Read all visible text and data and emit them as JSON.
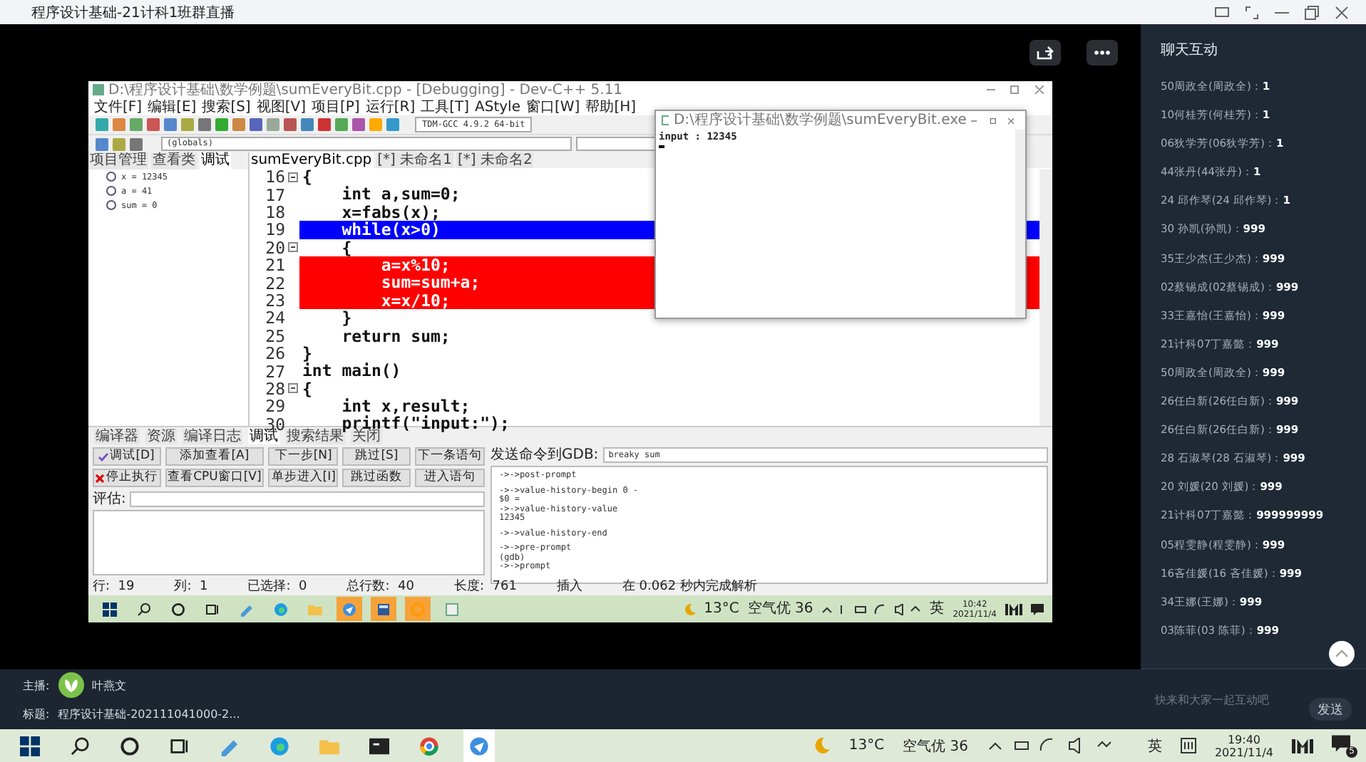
{
  "window": {
    "title": "程序设计基础-21计科1班群直播"
  },
  "shared_screen": {
    "ide": {
      "title": "D:\\程序设计基础\\数学例题\\sumEveryBit.cpp - [Debugging] - Dev-C++ 5.11",
      "menu": [
        "文件[F]",
        "编辑[E]",
        "搜索[S]",
        "视图[V]",
        "项目[P]",
        "运行[R]",
        "工具[T]",
        "AStyle",
        "窗口[W]",
        "帮助[H]"
      ],
      "compiler": "TDM-GCC 4.9.2 64-bit",
      "scope": "(globals)",
      "left_tabs": [
        {
          "label": "项目管理",
          "selected": false
        },
        {
          "label": "查看类",
          "selected": false
        },
        {
          "label": "调试",
          "selected": true
        }
      ],
      "watches": [
        "x = 12345",
        "a = 41",
        "sum = 0"
      ],
      "editor_tabs": [
        {
          "label": "sumEveryBit.cpp",
          "selected": true
        },
        {
          "label": "[*] 未命名1",
          "selected": false
        },
        {
          "label": "[*] 未命名2",
          "selected": false
        }
      ],
      "code": [
        {
          "n": "16",
          "text": "{",
          "kind": "normal",
          "fold": true
        },
        {
          "n": "17",
          "text": "    int a,sum=0;",
          "kind": "normal",
          "fold": false
        },
        {
          "n": "18",
          "text": "    x=fabs(x);",
          "kind": "normal",
          "fold": false
        },
        {
          "n": "19",
          "text": "    while(x>0)",
          "kind": "current",
          "fold": false
        },
        {
          "n": "20",
          "text": "    {",
          "kind": "normal",
          "fold": true
        },
        {
          "n": "21",
          "text": "        a=x%10;",
          "kind": "breakpoint",
          "fold": false
        },
        {
          "n": "22",
          "text": "        sum=sum+a;",
          "kind": "breakpoint",
          "fold": false
        },
        {
          "n": "23",
          "text": "        x=x/10;",
          "kind": "breakpoint",
          "fold": false
        },
        {
          "n": "24",
          "text": "    }",
          "kind": "normal",
          "fold": false
        },
        {
          "n": "25",
          "text": "    return sum;",
          "kind": "normal",
          "fold": false
        },
        {
          "n": "26",
          "text": "}",
          "kind": "normal",
          "fold": false
        },
        {
          "n": "27",
          "text": "int main()",
          "kind": "normal",
          "fold": false
        },
        {
          "n": "28",
          "text": "{",
          "kind": "normal",
          "fold": true
        },
        {
          "n": "29",
          "text": "    int x,result;",
          "kind": "normal",
          "fold": false
        },
        {
          "n": "30",
          "text": "    printf(\"input:\");",
          "kind": "normal",
          "fold": false
        }
      ],
      "bottom_tabs": [
        {
          "label": "编译器",
          "selected": false
        },
        {
          "label": "资源",
          "selected": false
        },
        {
          "label": "编译日志",
          "selected": false
        },
        {
          "label": "调试",
          "selected": true
        },
        {
          "label": "搜索结果",
          "selected": false
        },
        {
          "label": "关闭",
          "selected": false
        }
      ],
      "debug_buttons": [
        {
          "label": "调试[D]",
          "kind": "check"
        },
        {
          "label": "添加查看[A]",
          "kind": "plain"
        },
        {
          "label": "下一步[N]",
          "kind": "plain"
        },
        {
          "label": "跳过[S]",
          "kind": "plain"
        },
        {
          "label": "下一条语句",
          "kind": "plain"
        },
        {
          "label": "停止执行",
          "kind": "stop"
        },
        {
          "label": "查看CPU窗口[V]",
          "kind": "plain"
        },
        {
          "label": "单步进入[I]",
          "kind": "plain"
        },
        {
          "label": "跳过函数",
          "kind": "plain"
        },
        {
          "label": "进入语句",
          "kind": "plain"
        }
      ],
      "evaluate_label": "评估:",
      "gdb": {
        "label": "发送命令到GDB:",
        "value": "breaky sum"
      },
      "gdb_output": [
        [
          "->->post-prompt"
        ],
        [
          "->->value-history-begin 0 -",
          "$0 =",
          "->->value-history-value",
          "12345"
        ],
        [
          "->->value-history-end"
        ],
        [
          "->->pre-prompt",
          "(gdb)",
          "->->prompt"
        ]
      ],
      "status": [
        {
          "label": "行:",
          "value": "19"
        },
        {
          "label": "列:",
          "value": "1"
        },
        {
          "label": "已选择:",
          "value": "0"
        },
        {
          "label": "总行数:",
          "value": "40"
        },
        {
          "label": "长度:",
          "value": "761"
        },
        {
          "label": "插入"
        },
        {
          "label": "在 0.062 秒内完成解析"
        }
      ]
    },
    "console": {
      "title": "D:\\程序设计基础\\数学例题\\sumEveryBit.exe",
      "output": "input : 12345"
    },
    "taskbar": {
      "apps": [
        {
          "kind": "start",
          "selected": false
        },
        {
          "kind": "search",
          "selected": false
        },
        {
          "kind": "cortana",
          "selected": false
        },
        {
          "kind": "taskview",
          "selected": false
        },
        {
          "kind": "pen",
          "selected": false
        },
        {
          "kind": "edge",
          "selected": false
        },
        {
          "kind": "folder",
          "selected": false
        },
        {
          "kind": "bird",
          "selected": true
        },
        {
          "kind": "calc",
          "selected": true
        },
        {
          "kind": "ring",
          "selected": true
        },
        {
          "kind": "app",
          "selected": false
        }
      ],
      "weather": "13°C",
      "air": "空气优 36",
      "ime": "英",
      "time": "10:42",
      "date": "2021/11/4"
    }
  },
  "chat": {
    "title": "聊天互动",
    "messages": [
      {
        "sender": "50周政全(周政全)：",
        "text": "1"
      },
      {
        "sender": "10何桂芳(何桂芳)：",
        "text": "1"
      },
      {
        "sender": "06狄学芳(06狄学芳)：",
        "text": "1"
      },
      {
        "sender": "44张丹(44张丹)：",
        "text": "1"
      },
      {
        "sender": "24 邱作琴(24 邱作琴)：",
        "text": "1"
      },
      {
        "sender": "30 孙凯(孙凯)：",
        "text": "999"
      },
      {
        "sender": "35王少杰(王少杰)：",
        "text": "999"
      },
      {
        "sender": "02蔡锡成(02蔡锡成)：",
        "text": "999"
      },
      {
        "sender": "33王嘉怡(王嘉怡)：",
        "text": "999"
      },
      {
        "sender": "21计科07丁嘉懿：",
        "text": "999"
      },
      {
        "sender": "50周政全(周政全)：",
        "text": "999"
      },
      {
        "sender": "26任白新(26任白新)：",
        "text": "999"
      },
      {
        "sender": "26任白新(26任白新)：",
        "text": "999"
      },
      {
        "sender": "28 石淑琴(28 石淑琴)：",
        "text": "999"
      },
      {
        "sender": "20 刘媛(20 刘媛)：",
        "text": "999"
      },
      {
        "sender": "21计科07丁嘉懿：",
        "text": "999999999"
      },
      {
        "sender": "05程雯静(程雯静)：",
        "text": "999"
      },
      {
        "sender": "16吝佳媛(16 吝佳媛)：",
        "text": "999"
      },
      {
        "sender": "34王娜(王娜)：",
        "text": "999"
      },
      {
        "sender": "03陈菲(03 陈菲)：",
        "text": "999"
      }
    ],
    "placeholder": "快来和大家一起互动吧",
    "send": "发送"
  },
  "host": {
    "label": "主播:",
    "name": "叶燕文"
  },
  "stream_title": {
    "label": "标题:",
    "value": "程序设计基础-202111041000-2..."
  },
  "taskbar": {
    "apps": [
      {
        "kind": "start",
        "selected": false
      },
      {
        "kind": "search",
        "selected": false
      },
      {
        "kind": "cortana",
        "selected": false
      },
      {
        "kind": "taskview",
        "selected": false
      },
      {
        "kind": "pen",
        "selected": false
      },
      {
        "kind": "edge",
        "selected": false
      },
      {
        "kind": "folder",
        "selected": false
      },
      {
        "kind": "terminal",
        "selected": false
      },
      {
        "kind": "chrome",
        "selected": false
      },
      {
        "kind": "bird",
        "selected": true
      }
    ],
    "weather": "13°C",
    "air": "空气优 36",
    "ime": "英",
    "time": "19:40",
    "date": "2021/11/4",
    "notifications": "5"
  }
}
